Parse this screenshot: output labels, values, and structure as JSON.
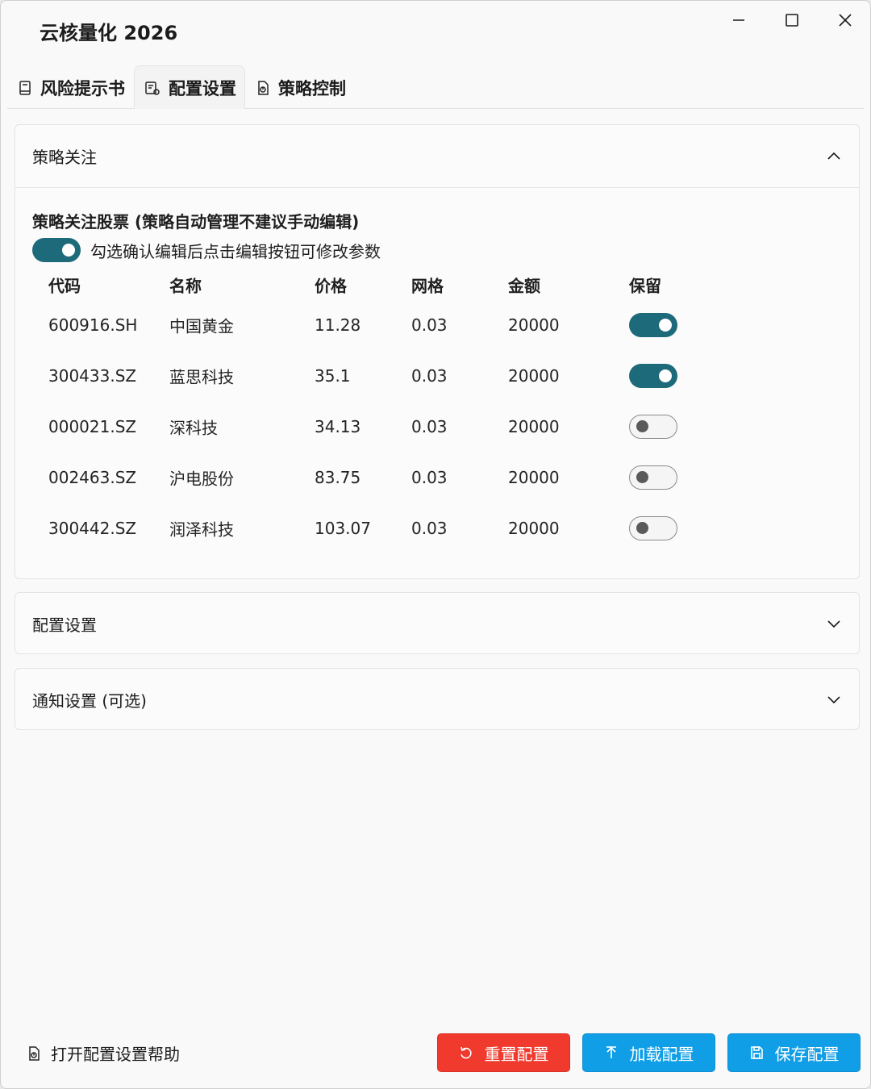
{
  "window": {
    "title": "云核量化 2026"
  },
  "tabs": [
    {
      "label": "风险提示书",
      "icon": "document-icon",
      "active": false
    },
    {
      "label": "配置设置",
      "icon": "settings-document-icon",
      "active": true
    },
    {
      "label": "策略控制",
      "icon": "strategy-document-icon",
      "active": false
    }
  ],
  "strategy_panel": {
    "header": "策略关注",
    "expanded": true,
    "section_title": "策略关注股票 (策略自动管理不建议手动编辑)",
    "confirm_label": "勾选确认编辑后点击编辑按钮可修改参数",
    "confirm_on": true,
    "columns": [
      "代码",
      "名称",
      "价格",
      "网格",
      "金额",
      "保留"
    ],
    "rows": [
      {
        "code": "600916.SH",
        "name": "中国黄金",
        "price": "11.28",
        "grid": "0.03",
        "amount": "20000",
        "keep": true
      },
      {
        "code": "300433.SZ",
        "name": "蓝思科技",
        "price": "35.1",
        "grid": "0.03",
        "amount": "20000",
        "keep": true
      },
      {
        "code": "000021.SZ",
        "name": "深科技",
        "price": "34.13",
        "grid": "0.03",
        "amount": "20000",
        "keep": false
      },
      {
        "code": "002463.SZ",
        "name": "沪电股份",
        "price": "83.75",
        "grid": "0.03",
        "amount": "20000",
        "keep": false
      },
      {
        "code": "300442.SZ",
        "name": "润泽科技",
        "price": "103.07",
        "grid": "0.03",
        "amount": "20000",
        "keep": false
      }
    ]
  },
  "config_panel": {
    "header": "配置设置",
    "expanded": false
  },
  "notify_panel": {
    "header": "通知设置 (可选)",
    "expanded": false
  },
  "footer": {
    "help_label": "打开配置设置帮助",
    "reset_label": "重置配置",
    "load_label": "加载配置",
    "save_label": "保存配置"
  },
  "colors": {
    "toggle_on": "#1d6a7a",
    "reset_button": "#f03a2e",
    "primary_button": "#109ee6"
  }
}
